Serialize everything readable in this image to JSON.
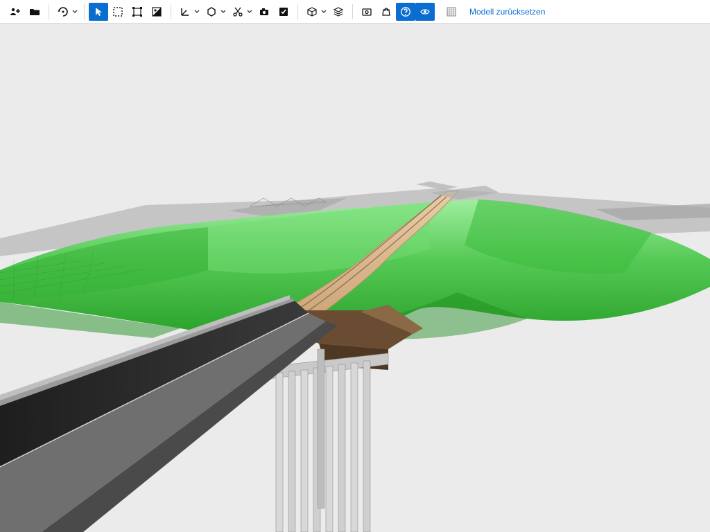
{
  "toolbar": {
    "reset_label": "Modell zurücksetzen",
    "icons": {
      "invite": "invite-icon",
      "folder": "folder-icon",
      "orbit": "orbit-icon",
      "cursor": "cursor-icon",
      "select_box": "select-box-icon",
      "transform": "transform-icon",
      "exposure": "exposure-icon",
      "axis": "axis-icon",
      "shape": "shape-icon",
      "cut": "cut-icon",
      "camera": "camera-icon",
      "check": "check-icon",
      "package": "package-icon",
      "stack": "stack-icon",
      "layers": "layers-icon",
      "shop": "shop-icon",
      "help": "help-icon",
      "eye": "eye-icon",
      "grid": "grid-icon"
    }
  },
  "scene": {
    "terrain_color_light": "#8ae68a",
    "terrain_color_mid": "#55c955",
    "terrain_color_dark": "#2aa22a",
    "road_color": "#d9b38c",
    "road_edge": "#b88e64",
    "bridge_deck": "#2b2b2b",
    "bridge_side": "#6f6f6f",
    "pier_color": "#d4d4d4",
    "pier_shadow": "#aaaaaa",
    "abutment_color": "#5a4230",
    "far_grey": "#9c9c9c"
  }
}
